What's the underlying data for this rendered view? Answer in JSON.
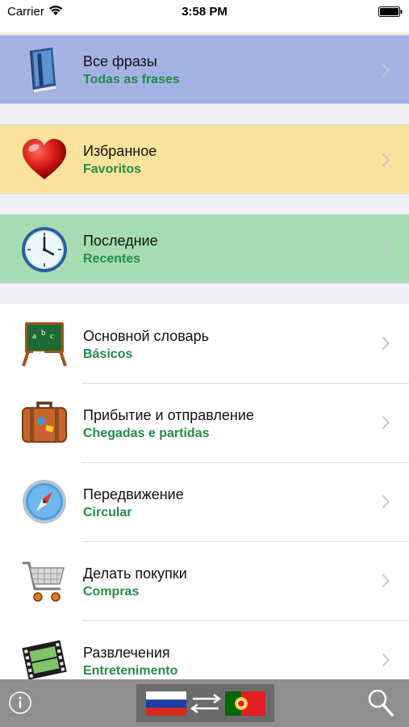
{
  "status_bar": {
    "carrier": "Carrier",
    "time": "3:58 PM"
  },
  "colors": {
    "all_phrases_bg": "#a4b2e4",
    "favorites_bg": "#fbe39b",
    "recent_bg": "#a6dcb1",
    "subtitle": "#218c48",
    "toolbar_bg": "#8f8f8f"
  },
  "feature_rows": [
    {
      "title": "Все фразы",
      "subtitle": "Todas as frases",
      "icon": "book-icon"
    },
    {
      "title": "Избранное",
      "subtitle": "Favoritos",
      "icon": "heart-icon"
    },
    {
      "title": "Последние",
      "subtitle": "Recentes",
      "icon": "clock-icon"
    }
  ],
  "category_rows": [
    {
      "title": "Основной словарь",
      "subtitle": "Básicos",
      "icon": "chalkboard-icon"
    },
    {
      "title": "Прибытие и отправление",
      "subtitle": "Chegadas e partidas",
      "icon": "suitcase-icon"
    },
    {
      "title": "Передвижение",
      "subtitle": "Circular",
      "icon": "compass-icon"
    },
    {
      "title": "Делать покупки",
      "subtitle": "Compras",
      "icon": "shopping-cart-icon"
    },
    {
      "title": "Развлечения",
      "subtitle": "Entretenimento",
      "icon": "film-icon"
    }
  ],
  "toolbar": {
    "info": "info-icon",
    "language_pair": "russian-to-portuguese-flags",
    "search": "search-icon"
  }
}
